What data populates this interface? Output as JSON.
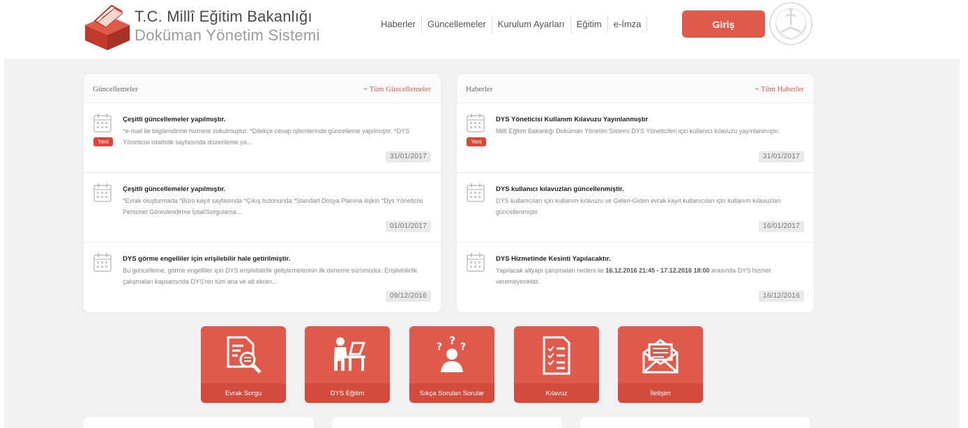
{
  "header": {
    "brand_title": "T.C. Millî Eğitim Bakanlığı",
    "brand_subtitle": "Doküman Yönetim Sistemi",
    "nav": [
      "Haberler",
      "Güncellemeler",
      "Kurulum Ayarları",
      "Eğitim",
      "e-İmza"
    ],
    "login_label": "Giriş",
    "logo_icon": "dys-box-logo-icon",
    "seal_icon": "meb-seal-icon"
  },
  "colors": {
    "accent": "#e05a4c",
    "accent_dark": "#d44a3d",
    "badge": "#d9463a",
    "background": "#f1f1f1"
  },
  "updates": {
    "title": "Güncellemeler",
    "more_label": "+ Tüm Güncellemeler",
    "items": [
      {
        "title": "Çeşitli güncellemeler yapılmıştır.",
        "text": "*e-mail ile bilgilendirme hizmete sokulmuştur. *Dilekçe cevap işlemlerinde güncelleme yapılmıştır. *DYS Yöneticisi istatistik sayfasında düzenleme ya...",
        "badge": "Yeni",
        "date": "31/01/2017"
      },
      {
        "title": "Çeşitli güncellemeler yapılmıştır.",
        "text": "*Evrak oluşturmada *Büro kayıt sayfasında *Çıkış butonunda *Standart Dosya Planına ilişkin *Dys Yöneticisi Personel Görevlendirme İptal/Sorgulama...",
        "badge": "",
        "date": "01/01/2017"
      },
      {
        "title": "DYS görme engelliler için erişilebilir hale getirilmiştir.",
        "text": "Bu güncelleme, görme engelliler için DYS erişilebilirlik geliştirmelerinin ilk deneme sürümüdür. Erişilebilirlik çalışmaları kapsamında DYS'nin tüm ana ve alt ekran...",
        "badge": "",
        "date": "09/12/2016"
      }
    ]
  },
  "news": {
    "title": "Haberler",
    "more_label": "+ Tüm Haberler",
    "items": [
      {
        "title": "DYS Yöneticisi Kullanım Kılavuzu Yayınlanmıştır",
        "text": "Millî Eğitim Bakanlığı Doküman Yönetim Sistemi DYS Yöneticileri için kullanıcı kılavuzu yayınlanmıştır.",
        "badge": "Yeni",
        "date": "31/01/2017"
      },
      {
        "title": "DYS kullanıcı kılavuzları güncellenmiştir.",
        "text": "DYS kullanıcıları için kullanım kılavuzu ve Gelen-Giden evrak kayıt kullanıcıları için kullanım kılavuzları güncellenmiştir.",
        "badge": "",
        "date": "16/01/2017"
      },
      {
        "title": "DYS Hizmetinde Kesinti Yapılacaktır.",
        "text_pre": "Yapılacak altyapı çalışmaları nedeni ile ",
        "text_bold": "16.12.2016 21:45 - 17.12.2016 18:00",
        "text_post": " arasında DYS hizmet veremeyecektir.",
        "badge": "",
        "date": "16/12/2016"
      }
    ]
  },
  "tiles": [
    {
      "label": "Evrak Sorgu",
      "icon": "document-search-icon"
    },
    {
      "label": "DYS Eğitim",
      "icon": "teacher-desk-icon"
    },
    {
      "label": "Sıkça Sorulan Sorular",
      "icon": "question-person-icon"
    },
    {
      "label": "Kılavuz",
      "icon": "checklist-icon"
    },
    {
      "label": "İletişim",
      "icon": "envelope-icon"
    }
  ]
}
